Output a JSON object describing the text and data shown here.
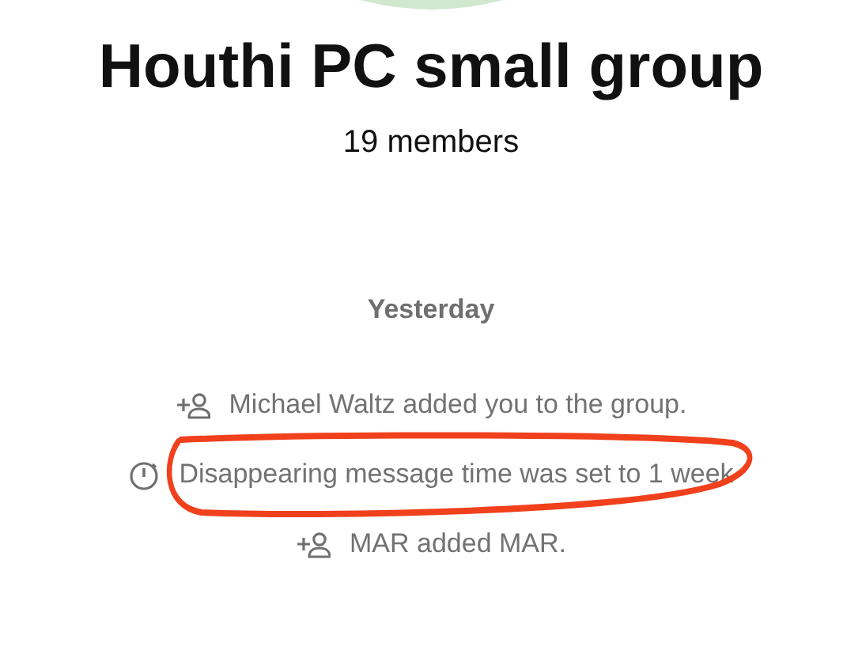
{
  "group": {
    "name": "Houthi PC small group",
    "members": "19 members"
  },
  "date_divider": "Yesterday",
  "events": [
    {
      "kind": "member_added",
      "text": "Michael Waltz added you to the group.",
      "circled": false
    },
    {
      "kind": "timer",
      "text": "Disappearing message time was set to 1 week",
      "circled": true
    },
    {
      "kind": "member_added",
      "text": "MAR added MAR.",
      "circled": false
    }
  ]
}
